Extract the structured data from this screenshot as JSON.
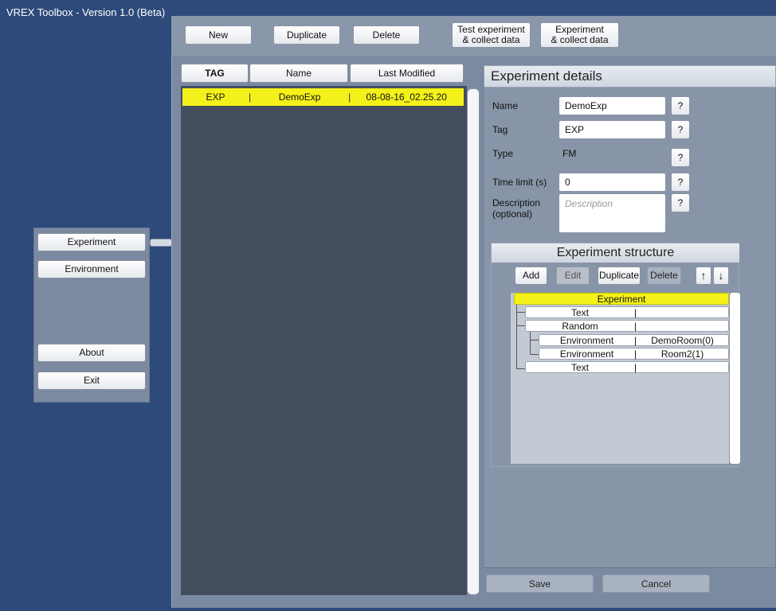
{
  "window": {
    "title": "VREX Toolbox - Version 1.0 (Beta)"
  },
  "toolbar": {
    "new": "New",
    "duplicate": "Duplicate",
    "delete": "Delete",
    "test_collect": "Test experiment\n& collect data",
    "exp_collect": "Experiment\n& collect data"
  },
  "nav": {
    "experiment": "Experiment",
    "environment": "Environment",
    "about": "About",
    "exit": "Exit"
  },
  "list": {
    "columns": [
      "TAG",
      "Name",
      "Last Modified"
    ],
    "rows": [
      {
        "tag": "EXP",
        "name": "DemoExp",
        "modified": "08-08-16_02.25.20"
      }
    ]
  },
  "details": {
    "heading": "Experiment details",
    "name_label": "Name",
    "name_value": "DemoExp",
    "tag_label": "Tag",
    "tag_value": "EXP",
    "type_label": "Type",
    "type_value": "FM",
    "time_label": "Time limit (s)",
    "time_value": "0",
    "desc_label": "Description\n(optional)",
    "desc_placeholder": "Description",
    "help": "?"
  },
  "structure": {
    "heading": "Experiment structure",
    "add": "Add",
    "edit": "Edit",
    "duplicate": "Duplicate",
    "delete": "Delete",
    "up": "↑",
    "down": "↓",
    "nodes": [
      {
        "label": "Experiment",
        "value": ""
      },
      {
        "label": "Text",
        "value": ""
      },
      {
        "label": "Random",
        "value": ""
      },
      {
        "label": "Environment",
        "value": "DemoRoom(0)"
      },
      {
        "label": "Environment",
        "value": "Room2(1)"
      },
      {
        "label": "Text",
        "value": ""
      }
    ]
  },
  "footer": {
    "save": "Save",
    "cancel": "Cancel"
  }
}
